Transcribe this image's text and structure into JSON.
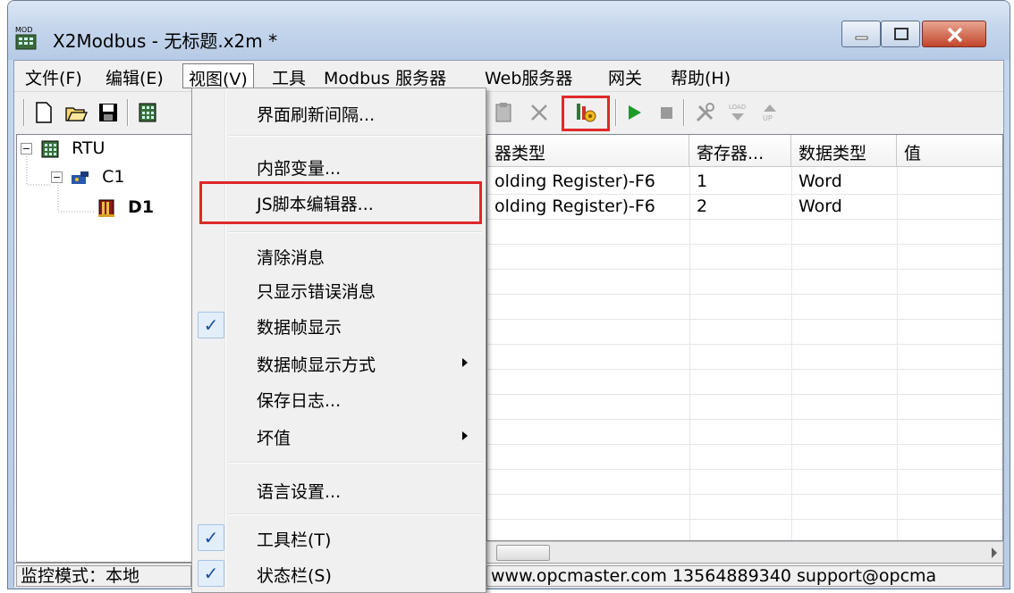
{
  "window": {
    "title": "X2Modbus - 无标题.x2m *",
    "app_icon_text": "MOD"
  },
  "menubar": {
    "items": [
      "文件(F)",
      "编辑(E)",
      "视图(V)",
      "工具",
      "Modbus 服务器",
      "Web服务器",
      "网关",
      "帮助(H)"
    ],
    "active_index": 2
  },
  "toolbar": {
    "icons": [
      "new-file-icon",
      "open-folder-icon",
      "save-icon",
      "device-icon",
      "paste-icon",
      "delete-icon",
      "js-script-icon",
      "run-icon",
      "stop-icon",
      "tools-icon",
      "load-icon",
      "upload-icon"
    ]
  },
  "tree": {
    "nodes": [
      {
        "label": "RTU",
        "expander": "⊟",
        "icon": "rtu-icon"
      },
      {
        "label": "C1",
        "expander": "⊟",
        "icon": "channel-icon"
      },
      {
        "label": "D1",
        "icon": "device-icon"
      }
    ]
  },
  "grid": {
    "headers": [
      "器类型",
      "寄存器...",
      "数据类型",
      "值"
    ],
    "rows": [
      {
        "type": "olding Register)-F6",
        "register": "1",
        "data_type": "Word",
        "value": ""
      },
      {
        "type": "olding Register)-F6",
        "register": "2",
        "data_type": "Word",
        "value": ""
      }
    ]
  },
  "statusbar": {
    "mode": "监控模式：本地",
    "pane2": "(",
    "contact": "www.opcmaster.com 13564889340 support@opcma"
  },
  "dropdown": {
    "items": [
      {
        "label": "界面刷新间隔...",
        "checked": false,
        "submenu": false
      },
      {
        "label": "内部变量...",
        "checked": false,
        "submenu": false
      },
      {
        "label": "JS脚本编辑器...",
        "checked": false,
        "submenu": false
      },
      {
        "label": "清除消息",
        "checked": false,
        "submenu": false
      },
      {
        "label": "只显示错误消息",
        "checked": false,
        "submenu": false
      },
      {
        "label": "数据帧显示",
        "checked": true,
        "submenu": false
      },
      {
        "label": "数据帧显示方式",
        "checked": false,
        "submenu": true
      },
      {
        "label": "保存日志...",
        "checked": false,
        "submenu": false
      },
      {
        "label": "坏值",
        "checked": false,
        "submenu": true
      },
      {
        "label": "语言设置...",
        "checked": false,
        "submenu": false
      },
      {
        "label": "工具栏(T)",
        "checked": true,
        "submenu": false
      },
      {
        "label": "状态栏(S)",
        "checked": true,
        "submenu": false
      }
    ],
    "check_glyph": "✓"
  },
  "colors": {
    "highlight_red": "#e0282a",
    "accent_blue": "#1c4e9c"
  }
}
